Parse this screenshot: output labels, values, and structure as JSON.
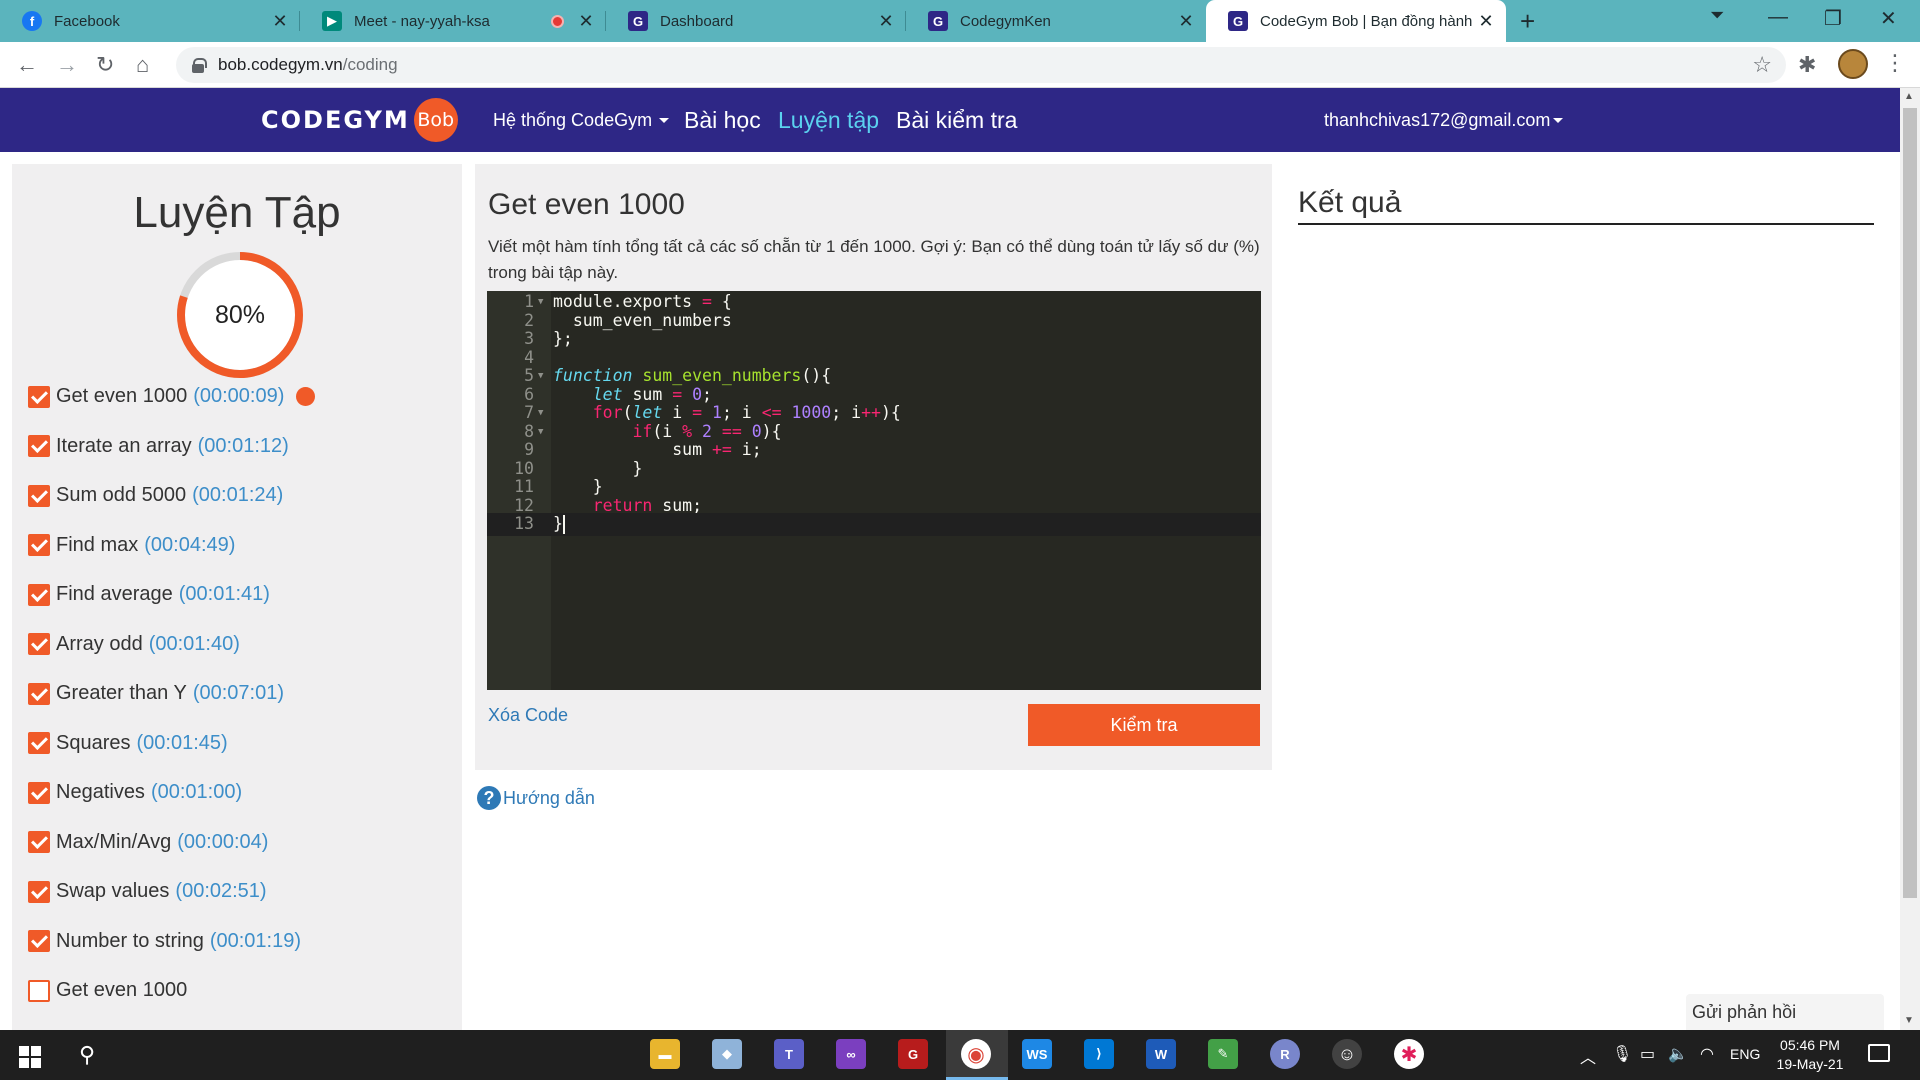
{
  "browser": {
    "tabs": [
      {
        "title": "Facebook",
        "icon": "facebook-icon",
        "color": "#1877f2"
      },
      {
        "title": "Meet - nay-yyah-ksa",
        "icon": "google-meet-icon",
        "color": "#00897b"
      },
      {
        "title": "Dashboard",
        "icon": "codegym-icon",
        "color": "#2e2786"
      },
      {
        "title": "CodegymKen",
        "icon": "codegym-icon",
        "color": "#2e2786"
      },
      {
        "title": "CodeGym Bob | Bạn đồng hành c",
        "icon": "codegym-icon",
        "color": "#2e2786"
      }
    ],
    "url_host": "bob.codegym.vn",
    "url_path": "/coding"
  },
  "site": {
    "logo_text": "CODEGYM",
    "logo_badge": "Bob",
    "nav": {
      "system": "Hệ thống CodeGym",
      "lessons": "Bài học",
      "practice": "Luyện tập",
      "tests": "Bài kiểm tra",
      "user": "thanhchivas172@gmail.com"
    }
  },
  "sidebar": {
    "title": "Luyện Tập",
    "progress_label": "80%",
    "progress_fraction": 0.8,
    "exercises": [
      {
        "name": "Get even 1000",
        "time": "(00:00:09)",
        "done": true,
        "current": true
      },
      {
        "name": "Iterate an array",
        "time": "(00:01:12)",
        "done": true
      },
      {
        "name": "Sum odd 5000",
        "time": "(00:01:24)",
        "done": true
      },
      {
        "name": "Find max",
        "time": "(00:04:49)",
        "done": true
      },
      {
        "name": "Find average",
        "time": "(00:01:41)",
        "done": true
      },
      {
        "name": "Array odd",
        "time": "(00:01:40)",
        "done": true
      },
      {
        "name": "Greater than Y",
        "time": "(00:07:01)",
        "done": true
      },
      {
        "name": "Squares",
        "time": "(00:01:45)",
        "done": true
      },
      {
        "name": "Negatives",
        "time": "(00:01:00)",
        "done": true
      },
      {
        "name": "Max/Min/Avg",
        "time": "(00:00:04)",
        "done": true
      },
      {
        "name": "Swap values",
        "time": "(00:02:51)",
        "done": true
      },
      {
        "name": "Number to string",
        "time": "(00:01:19)",
        "done": true
      },
      {
        "name": "Get even 1000",
        "time": "",
        "done": false
      }
    ]
  },
  "exercise": {
    "title": "Get even 1000",
    "description": "Viết một hàm tính tổng tất cả các số chẵn từ 1 đến 1000. Gợi ý: Bạn có thể dùng toán tử lấy số dư (%) trong bài tập này.",
    "code_lines": [
      "module.exports = {",
      "  sum_even_numbers",
      "};",
      "",
      "function sum_even_numbers(){",
      "    let sum = 0;",
      "    for(let i = 1; i <= 1000; i++){",
      "        if(i % 2 == 0){",
      "            sum += i;",
      "        }",
      "    }",
      "    return sum;",
      "}"
    ],
    "clear_label": "Xóa Code",
    "check_label": "Kiểm tra",
    "guide_label": "Hướng dẫn"
  },
  "result": {
    "title": "Kết quả"
  },
  "feedback_label": "Gửi phản hồi",
  "taskbar": {
    "language": "ENG",
    "time": "05:46 PM",
    "date": "19-May-21"
  },
  "colors": {
    "accent": "#f05a28",
    "nav_bg": "#2e2786",
    "nav_active": "#5bd2ef",
    "link": "#2e79b6",
    "tab_bar": "#5bb4bd"
  }
}
